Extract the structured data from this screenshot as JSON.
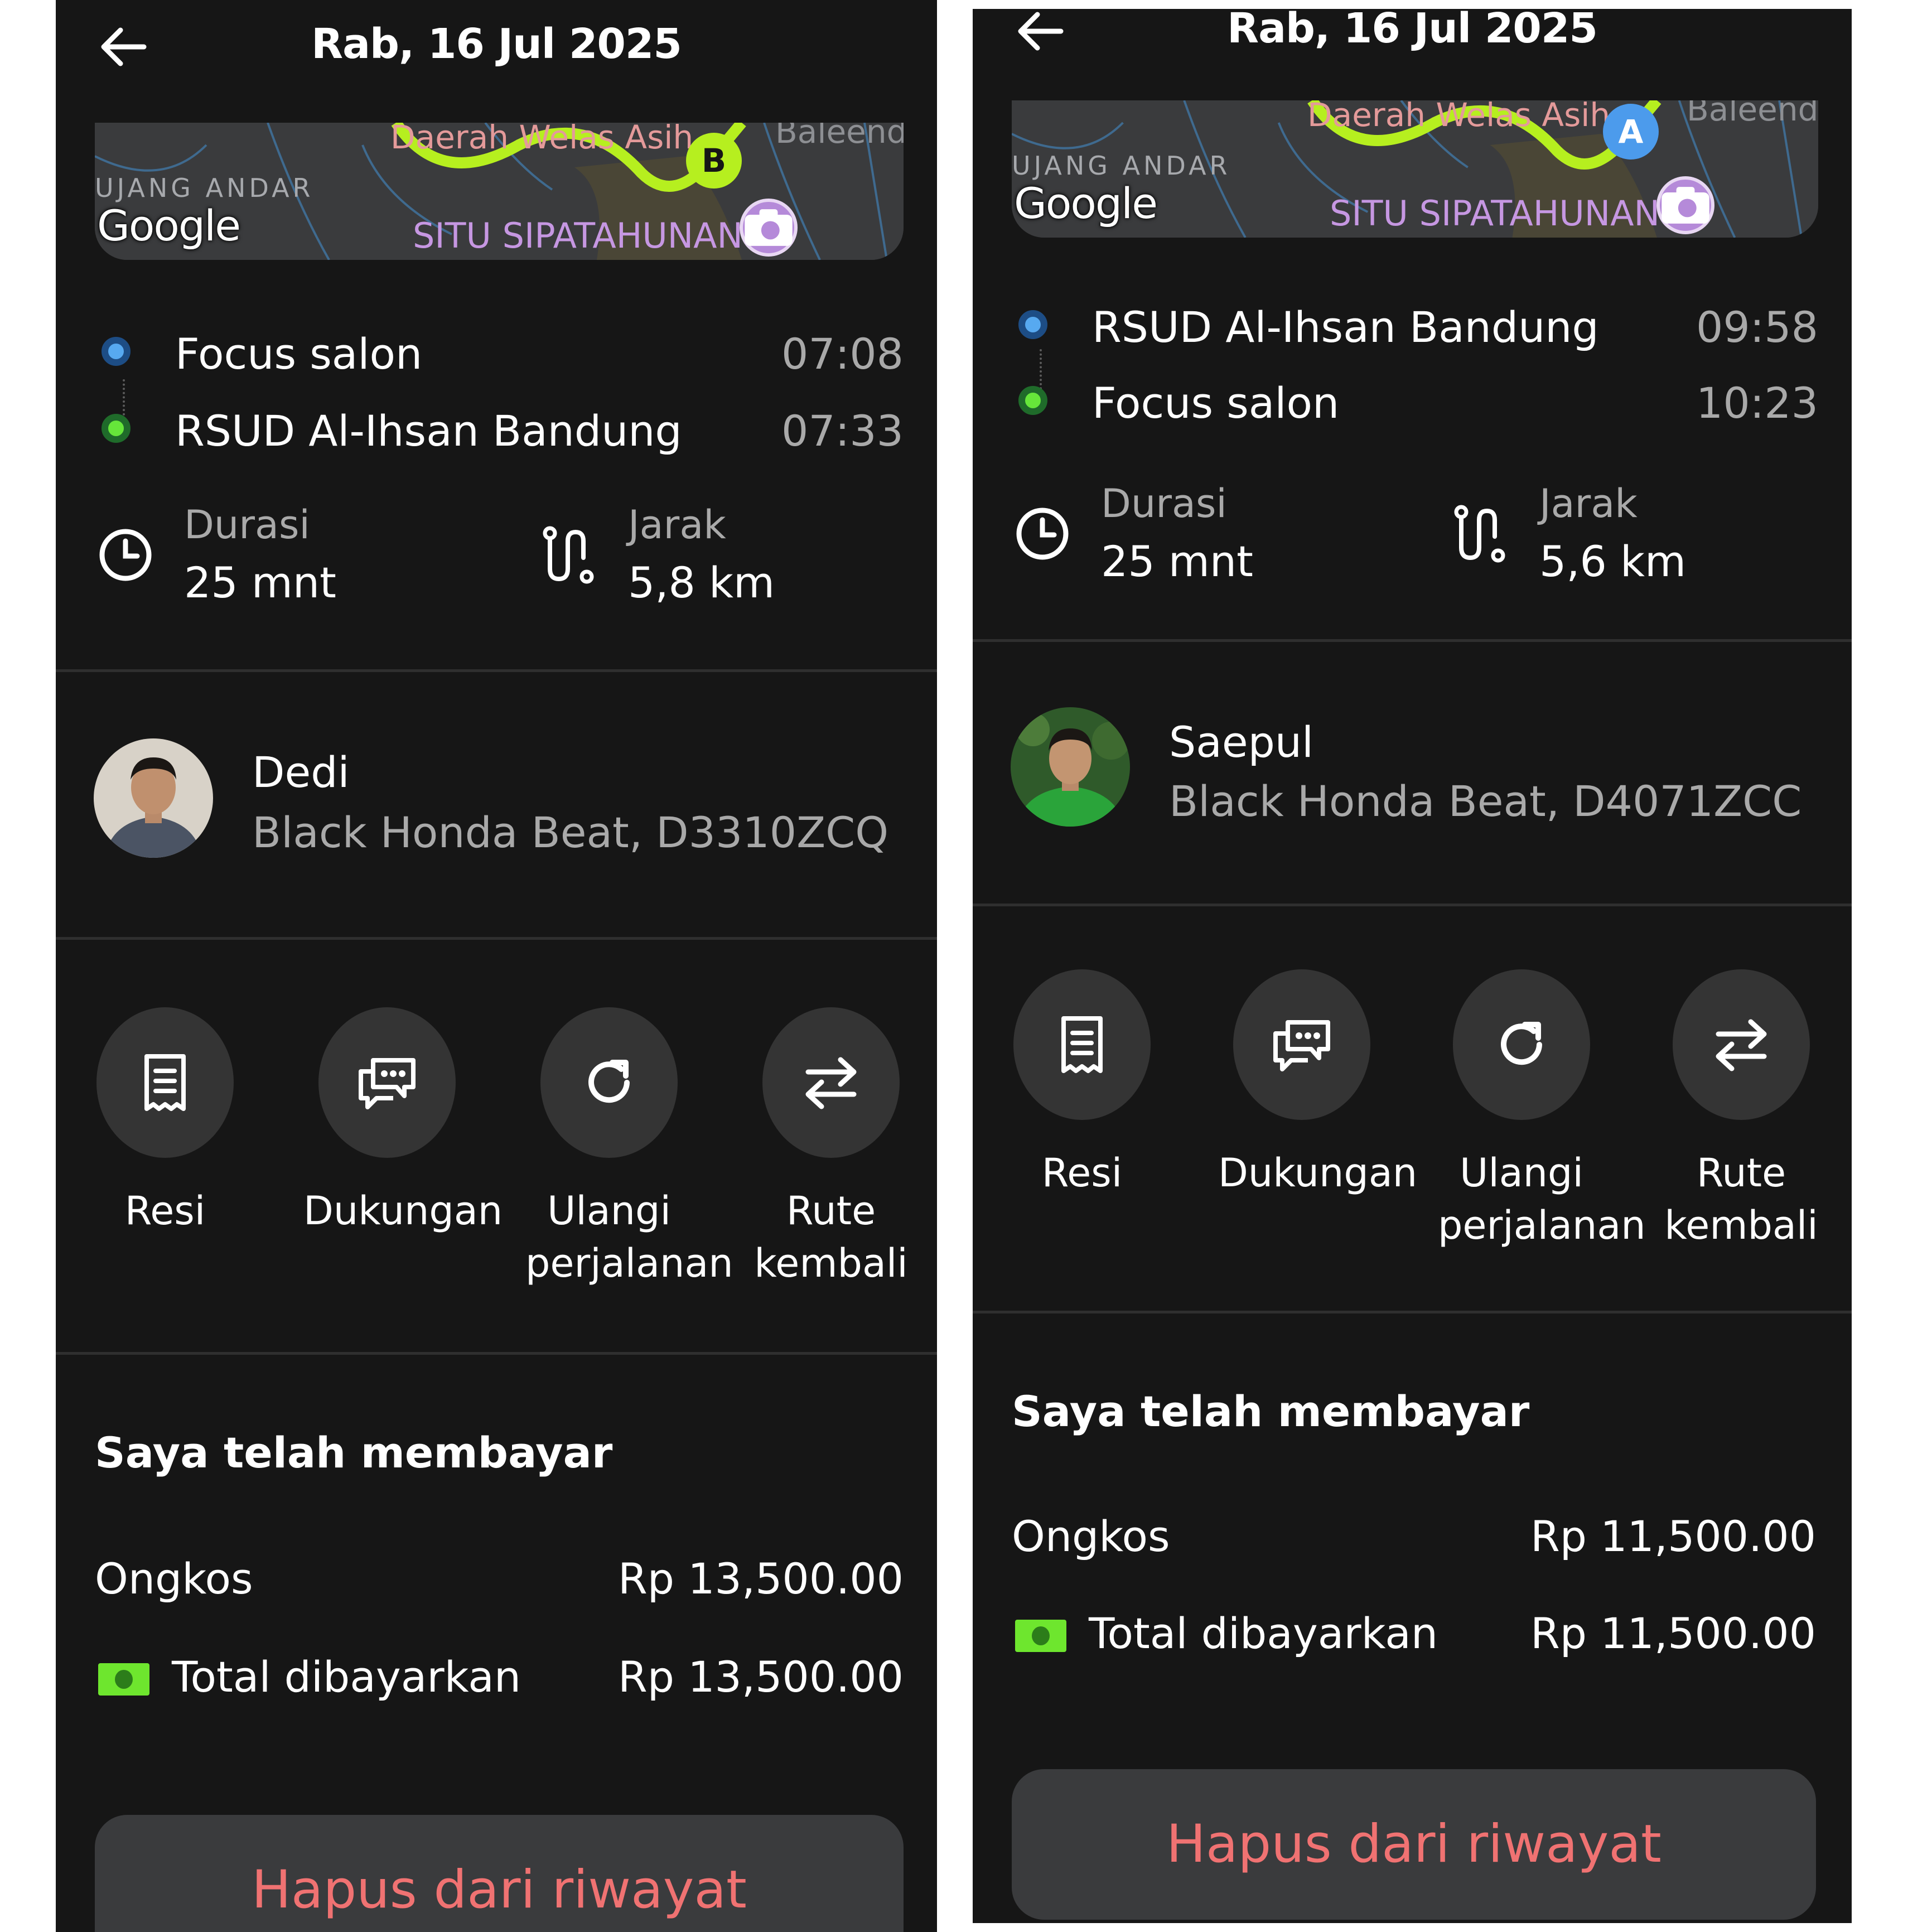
{
  "screens": [
    {
      "header": {
        "title": "Rab, 16 Jul 2025"
      },
      "map": {
        "area_label": "UJANG ANDAR",
        "place_label": "Daerah Welas Asih",
        "poi_label": "SITU SIPATAHUNAN",
        "edge_label": "Baleend",
        "google_label": "Google",
        "pin_letter": "B",
        "pin_color": "#b6ef1f"
      },
      "stops": [
        {
          "name": "Focus salon",
          "time": "07:08",
          "dot": "blue"
        },
        {
          "name": "RSUD Al-Ihsan Bandung",
          "time": "07:33",
          "dot": "green"
        }
      ],
      "stats": {
        "duration_label": "Durasi",
        "duration_value": "25 mnt",
        "distance_label": "Jarak",
        "distance_value": "5,8 km"
      },
      "driver": {
        "name": "Dedi",
        "vehicle": "Black Honda Beat, D3310ZCQ"
      },
      "actions": [
        {
          "label": "Resi",
          "icon": "receipt-icon"
        },
        {
          "label": "Dukungan",
          "icon": "chat-icon"
        },
        {
          "label": "Ulangi perjalanan",
          "icon": "refresh-icon"
        },
        {
          "label": "Rute kembali",
          "icon": "swap-icon"
        }
      ],
      "payment": {
        "title": "Saya telah membayar",
        "fare_label": "Ongkos",
        "fare_value": "Rp 13,500.00",
        "total_label": "Total dibayarkan",
        "total_value": "Rp 13,500.00"
      },
      "delete_label": "Hapus dari riwayat"
    },
    {
      "header": {
        "title": "Rab, 16 Jul 2025"
      },
      "map": {
        "area_label": "UJANG ANDAR",
        "place_label": "Daerah Welas Asih",
        "poi_label": "SITU SIPATAHUNAN",
        "edge_label": "Baleend",
        "google_label": "Google",
        "pin_letter": "A",
        "pin_color": "#4c9bec"
      },
      "stops": [
        {
          "name": "RSUD Al-Ihsan Bandung",
          "time": "09:58",
          "dot": "blue"
        },
        {
          "name": "Focus salon",
          "time": "10:23",
          "dot": "green"
        }
      ],
      "stats": {
        "duration_label": "Durasi",
        "duration_value": "25 mnt",
        "distance_label": "Jarak",
        "distance_value": "5,6 km"
      },
      "driver": {
        "name": "Saepul",
        "vehicle": "Black Honda Beat, D4071ZCC"
      },
      "actions": [
        {
          "label": "Resi",
          "icon": "receipt-icon"
        },
        {
          "label": "Dukungan",
          "icon": "chat-icon"
        },
        {
          "label": "Ulangi perjalanan",
          "icon": "refresh-icon"
        },
        {
          "label": "Rute kembali",
          "icon": "swap-icon"
        }
      ],
      "payment": {
        "title": "Saya telah membayar",
        "fare_label": "Ongkos",
        "fare_value": "Rp 11,500.00",
        "total_label": "Total dibayarkan",
        "total_value": "Rp 11,500.00"
      },
      "delete_label": "Hapus dari riwayat"
    }
  ],
  "colors": {
    "background": "#161616",
    "muted_text": "#a9a9a9",
    "danger_text": "#f07272",
    "route_line": "#b6ef1f",
    "cash_green": "#6ee62e"
  }
}
